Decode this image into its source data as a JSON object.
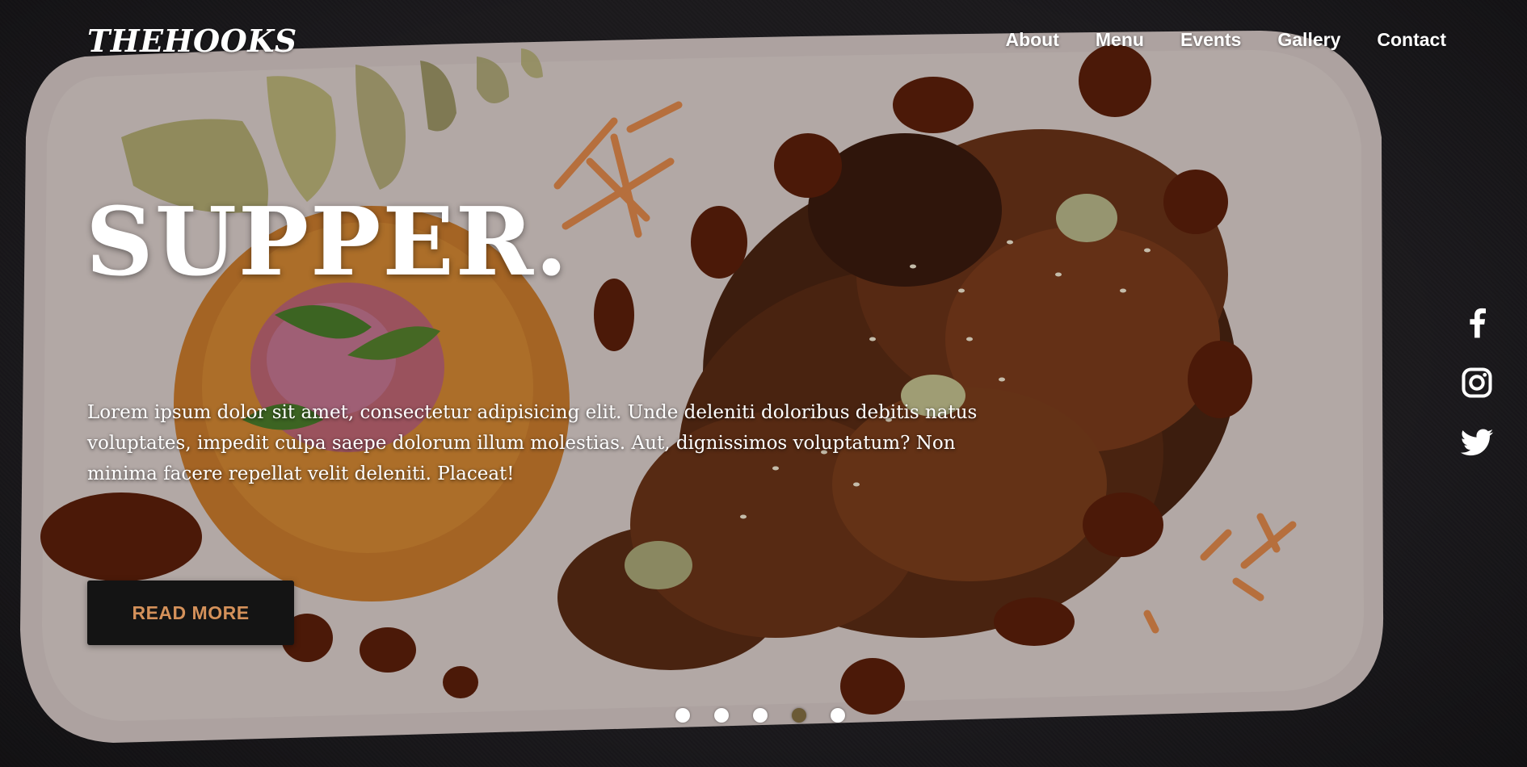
{
  "brand": {
    "logo": "THEHOOKS"
  },
  "nav": {
    "items": [
      "About",
      "Menu",
      "Events",
      "Gallery",
      "Contact"
    ]
  },
  "hero": {
    "title": "SUPPER.",
    "description": "Lorem ipsum dolor sit amet, consectetur adipisicing elit. Unde deleniti doloribus debitis natus voluptates, impedit culpa saepe dolorum illum molestias. Aut, dignissimos voluptatum? Non minima facere repellat velit deleniti. Placeat!",
    "cta_label": "READ MORE"
  },
  "social": {
    "icons": [
      "facebook-icon",
      "instagram-icon",
      "twitter-icon"
    ]
  },
  "carousel": {
    "slide_count": 5,
    "active_index": 3
  },
  "colors": {
    "cta_background": "#141414",
    "cta_text": "#d4915a",
    "background": "#222024",
    "plate": "#d8cbc8",
    "text": "#ffffff"
  }
}
